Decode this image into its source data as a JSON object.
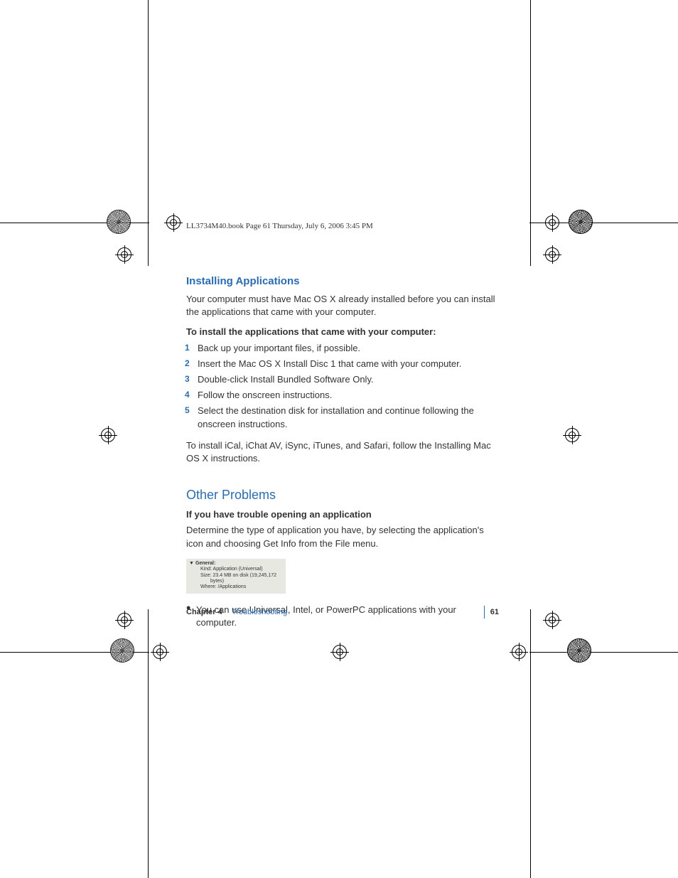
{
  "header_line": "LL3734M40.book  Page 61  Thursday, July 6, 2006  3:45 PM",
  "section1": {
    "title": "Installing Applications",
    "intro": "Your computer must have Mac OS X already installed before you can install the applications that came with your computer.",
    "subhead": "To install the applications that came with your computer:",
    "steps": [
      "Back up your important files, if possible.",
      "Insert the Mac OS X Install Disc 1 that came with your computer.",
      "Double-click Install Bundled Software Only.",
      "Follow the onscreen instructions.",
      "Select the destination disk for installation and continue following the onscreen instructions."
    ],
    "note": "To install iCal, iChat AV, iSync, iTunes, and Safari, follow the Installing Mac OS X instructions."
  },
  "section2": {
    "title": "Other Problems",
    "subhead": "If you have trouble opening an application",
    "intro": "Determine the type of application you have, by selecting the application's icon and choosing Get Info from the File menu.",
    "infobox": {
      "general": "General:",
      "kind_label": "Kind:",
      "kind_value": "Application (Universal)",
      "size_label": "Size:",
      "size_value": "23.4 MB on disk (19,245,172 bytes)",
      "where_label": "Where:",
      "where_value": "/Applications"
    },
    "bullets": [
      "You can use Universal, Intel, or PowerPC applications with your computer."
    ]
  },
  "footer": {
    "chapter_label": "Chapter 4",
    "chapter_title": "Troubleshooting",
    "page": "61"
  }
}
